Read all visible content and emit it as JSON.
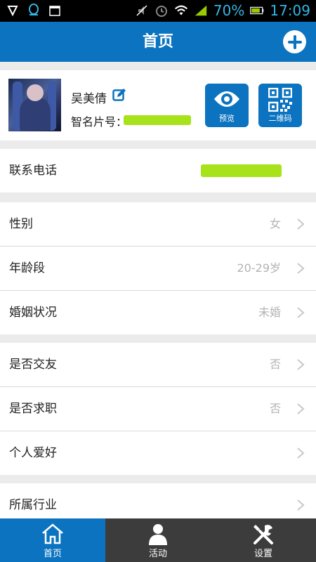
{
  "status_bar": {
    "battery": "70%",
    "time": "17:09"
  },
  "header": {
    "title": "首页"
  },
  "profile": {
    "name": "吴美倩",
    "card_label": "智名片号：",
    "preview_label": "预览",
    "qrcode_label": "二维码"
  },
  "contact": {
    "phone_label": "联系电话"
  },
  "fields": [
    {
      "label": "性别",
      "value": "女"
    },
    {
      "label": "年龄段",
      "value": "20-29岁"
    },
    {
      "label": "婚姻状况",
      "value": "未婚"
    },
    {
      "label": "是否交友",
      "value": "否"
    },
    {
      "label": "是否求职",
      "value": "否"
    },
    {
      "label": "个人爱好",
      "value": ""
    },
    {
      "label": "所属行业",
      "value": ""
    }
  ],
  "tabs": [
    {
      "label": "首页",
      "icon": "home-icon",
      "active": true
    },
    {
      "label": "活动",
      "icon": "person-icon",
      "active": false
    },
    {
      "label": "设置",
      "icon": "tools-icon",
      "active": false
    }
  ],
  "colors": {
    "primary": "#0b73bf",
    "tab_inactive": "#3c3c3c",
    "redaction": "#a8e21a"
  }
}
